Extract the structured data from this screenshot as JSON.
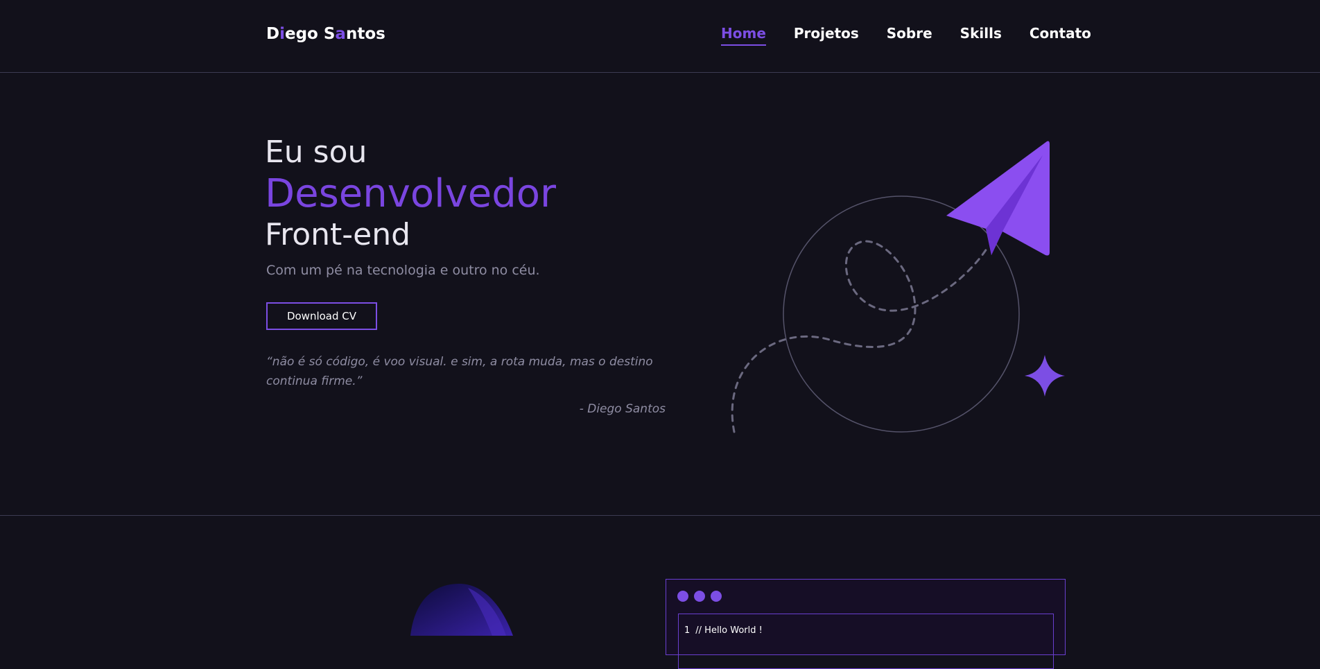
{
  "brand": {
    "logo_parts": [
      "D",
      "i",
      "ego S",
      "a",
      "ntos"
    ],
    "accent_color": "#7c4ee4",
    "background_color": "#12111b"
  },
  "nav": {
    "items": [
      {
        "label": "Home",
        "active": true
      },
      {
        "label": "Projetos",
        "active": false
      },
      {
        "label": "Sobre",
        "active": false
      },
      {
        "label": "Skills",
        "active": false
      },
      {
        "label": "Contato",
        "active": false
      }
    ]
  },
  "hero": {
    "line1": "Eu sou",
    "line2": "Desenvolvedor",
    "line3": "Front-end",
    "subtitle": "Com um pé na tecnologia e outro no céu.",
    "download_label": "Download CV",
    "quote": "“não é só código, é voo visual. e sim, a rota muda, mas o destino continua firme.”",
    "quote_author": "- Diego Santos",
    "icons": [
      "paper-plane-icon",
      "sparkle-star-icon"
    ]
  },
  "code_window": {
    "lines": [
      {
        "number": "1",
        "text": "// Hello World !"
      }
    ]
  }
}
